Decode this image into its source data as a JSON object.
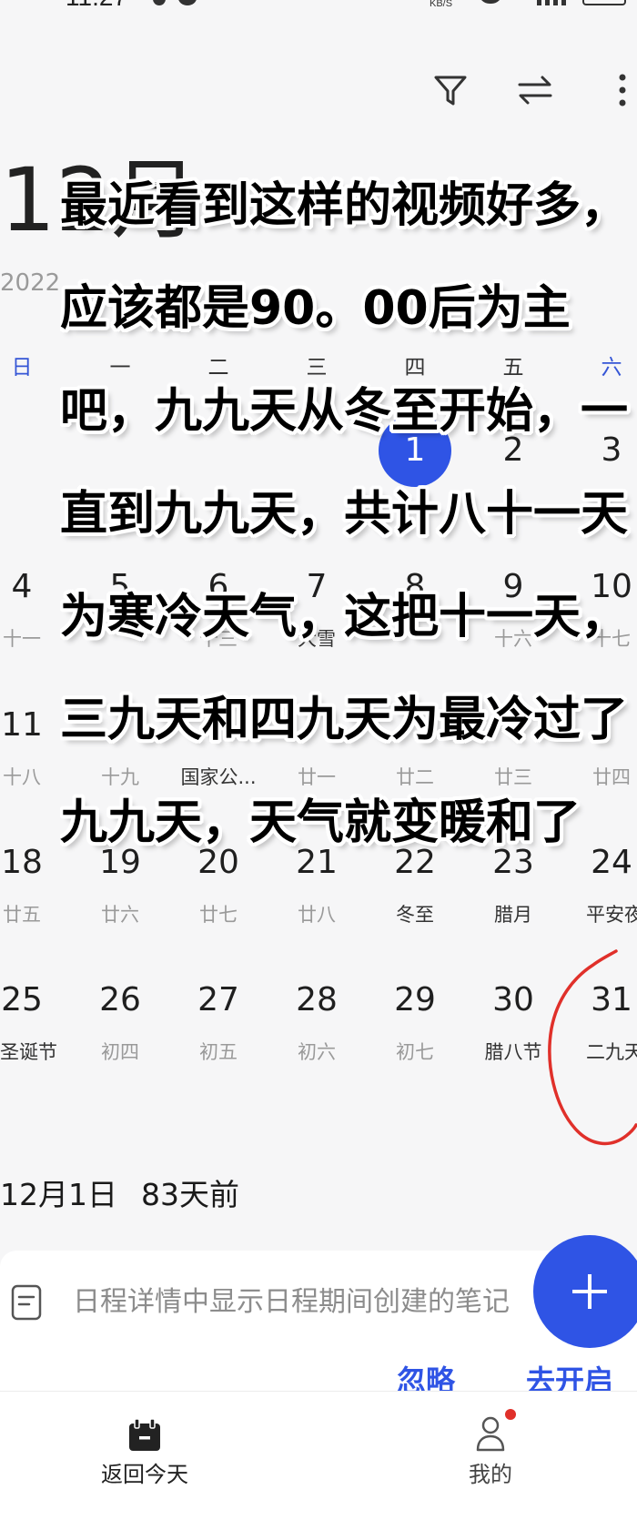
{
  "status_bar": {
    "time": "11:27",
    "net_speed": "KB/S"
  },
  "toolbar": {
    "filter_icon": "filter-icon",
    "swap_icon": "swap-arrows-icon",
    "more_icon": "more-vertical-icon"
  },
  "calendar": {
    "month_title": "12月",
    "year": "2022",
    "weekdays": [
      "日",
      "一",
      "二",
      "三",
      "四",
      "五",
      "六"
    ],
    "weeks": [
      [
        null,
        null,
        null,
        null,
        {
          "date": "1",
          "lunar": "",
          "selected": true
        },
        {
          "date": "2",
          "lunar": ""
        },
        {
          "date": "3",
          "lunar": ""
        }
      ],
      [
        {
          "date": "4",
          "lunar": "十一"
        },
        {
          "date": "5",
          "lunar": ""
        },
        {
          "date": "6",
          "lunar": "十三"
        },
        {
          "date": "7",
          "lunar": "大雪",
          "highlight": true
        },
        {
          "date": "8",
          "lunar": ""
        },
        {
          "date": "9",
          "lunar": "十六"
        },
        {
          "date": "10",
          "lunar": "十七"
        }
      ],
      [
        {
          "date": "11",
          "lunar": "十八"
        },
        {
          "date": "",
          "lunar": "十九"
        },
        {
          "date": "",
          "lunar": "国家公...",
          "highlight": true
        },
        {
          "date": "",
          "lunar": "廿一"
        },
        {
          "date": "",
          "lunar": "廿二"
        },
        {
          "date": "",
          "lunar": "廿三"
        },
        {
          "date": "",
          "lunar": "廿四"
        }
      ],
      [
        {
          "date": "18",
          "lunar": "廿五"
        },
        {
          "date": "19",
          "lunar": "廿六"
        },
        {
          "date": "20",
          "lunar": "廿七"
        },
        {
          "date": "21",
          "lunar": "廿八"
        },
        {
          "date": "22",
          "lunar": "冬至",
          "highlight": true
        },
        {
          "date": "23",
          "lunar": "腊月",
          "highlight": true
        },
        {
          "date": "24",
          "lunar": "平安夜",
          "highlight": true
        }
      ],
      [
        {
          "date": "25",
          "lunar": "圣诞节",
          "highlight": true
        },
        {
          "date": "26",
          "lunar": "初四"
        },
        {
          "date": "27",
          "lunar": "初五"
        },
        {
          "date": "28",
          "lunar": "初六"
        },
        {
          "date": "29",
          "lunar": "初七"
        },
        {
          "date": "30",
          "lunar": "腊八节",
          "highlight": true
        },
        {
          "date": "31",
          "lunar": "二九天",
          "highlight": true
        }
      ]
    ]
  },
  "overlay_text": {
    "lines": [
      "最近看到这样的视频好多，",
      "应该都是90。00后为主",
      "吧，九九天从冬至开始，一",
      "直到九九天，共计八十一天",
      "为寒冷天气，这把十一天，",
      "三九天和四九天为最冷过了",
      "九九天，天气就变暖和了"
    ]
  },
  "selected_info": {
    "date": "12月1日",
    "relative": "83天前"
  },
  "note_card": {
    "icon": "note-icon",
    "text": "日程详情中显示日程期间创建的笔记",
    "ignore_label": "忽略",
    "enable_label": "去开启"
  },
  "fab": {
    "icon": "plus-icon"
  },
  "bottom_nav": {
    "today": {
      "label": "返回今天",
      "icon": "calendar-today-icon"
    },
    "mine": {
      "label": "我的",
      "icon": "person-icon",
      "badge": true
    }
  },
  "colors": {
    "accent": "#2f54e5",
    "weekend": "#3556d6",
    "annotation": "#e0302a"
  }
}
